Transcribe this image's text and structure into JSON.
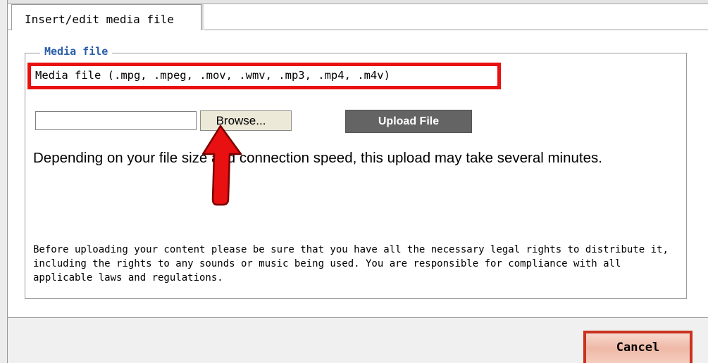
{
  "tab": {
    "label": "Insert/edit media file"
  },
  "fieldset": {
    "legend": "Media file",
    "file_types_label": "Media file (.mpg, .mpeg, .mov, .wmv, .mp3, .mp4, .m4v)"
  },
  "file_input": {
    "value": ""
  },
  "buttons": {
    "browse": "Browse...",
    "upload": "Upload File",
    "cancel": "Cancel"
  },
  "upload_note": "Depending on your file size and connection speed, this upload may take several minutes.",
  "legal_note": "Before uploading your content please be sure that you have all the necessary legal rights to distribute it, including the rights to any sounds or music being used. You are responsible for compliance with all applicable laws and regulations.",
  "annotation": {
    "highlight_color": "#e81010",
    "arrow_color": "#e81010"
  }
}
